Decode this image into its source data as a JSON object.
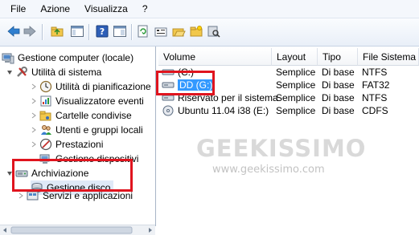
{
  "menu": [
    "File",
    "Azione",
    "Visualizza",
    "?"
  ],
  "toolbar": {
    "buttons": [
      "back-arrow",
      "forward-arrow",
      "folder-up",
      "console-tree",
      "help",
      "properties-window",
      "refresh",
      "properties",
      "open-folder",
      "new-folder",
      "disk-search"
    ]
  },
  "tree": {
    "root": "Gestione computer (locale)",
    "system_tools": "Utilità di sistema",
    "items": [
      "Utilità di pianificazione",
      "Visualizzatore eventi",
      "Cartelle condivise",
      "Utenti e gruppi locali",
      "Prestazioni",
      "Gestione dispositivi"
    ],
    "storage": "Archiviazione",
    "disk_mgmt": "Gestione disco",
    "services": "Servizi e applicazioni"
  },
  "table": {
    "columns": [
      "Volume",
      "Layout",
      "Tipo",
      "File Sistema"
    ],
    "rows": [
      [
        "(C:)",
        "Semplice",
        "Di base",
        "NTFS"
      ],
      [
        "DD (G:)",
        "Semplice",
        "Di base",
        "FAT32"
      ],
      [
        "Riservato per il sistema",
        "Semplice",
        "Di base",
        "NTFS"
      ],
      [
        "Ubuntu 11.04 i38 (E:)",
        "Semplice",
        "Di base",
        "CDFS"
      ]
    ]
  },
  "watermark": {
    "brand": "GEEKISSIMO",
    "url": "www.geekissimo.com"
  },
  "colors": {
    "highlight": "#e0141e",
    "selection": "#3399ff"
  }
}
